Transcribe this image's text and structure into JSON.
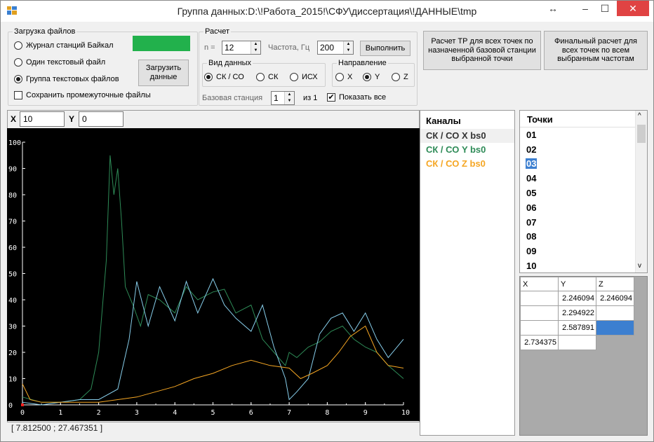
{
  "window": {
    "title": "Группа данных:D:\\!Работа_2015!\\СФУ\\диссертация\\!ДАННЫЕ\\tmp",
    "restore_glyph": "↔",
    "minimize_glyph": "–",
    "maximize_glyph": "☐",
    "close_glyph": "✕"
  },
  "load": {
    "legend": "Загрузка файлов",
    "options": [
      "Журнал станций Байкал",
      "Один текстовый файл",
      "Группа текстовых файлов"
    ],
    "selected": 2,
    "save_intermediate": "Сохранить промежуточные файлы",
    "save_checked": false,
    "load_button": "Загрузить данные",
    "status_color": "#22b14c"
  },
  "calc": {
    "legend": "Расчет",
    "n_label": "n =",
    "n_value": "12",
    "freq_label": "Частота, Гц",
    "freq_value": "200",
    "run_button": "Выполнить",
    "view_legend": "Вид данных",
    "view_options": [
      "СК / СО",
      "СК",
      "ИСХ"
    ],
    "view_selected": 0,
    "dir_legend": "Направление",
    "dir_options": [
      "X",
      "Y",
      "Z"
    ],
    "dir_selected": 1,
    "base_label": "Базовая станция",
    "base_value": "1",
    "base_of": "из 1",
    "show_all": "Показать все",
    "show_all_checked": true
  },
  "actions": {
    "tr_button": "Расчет ТР для всех точек по назначенной базовой станции выбранной точки",
    "final_button": "Финальный расчет для всех точек по всем выбранным частотам"
  },
  "coords": {
    "x_label": "X",
    "x_value": "10",
    "y_label": "Y",
    "y_value": "0"
  },
  "status": {
    "cursor": "[ 7.812500 ; 27.467351 ]"
  },
  "channels": {
    "title": "Каналы",
    "items": [
      {
        "label": "СК / СО X bs0",
        "color": "#333333"
      },
      {
        "label": "СК / СО Y bs0",
        "color": "#2e8b57"
      },
      {
        "label": "СК / СО Z bs0",
        "color": "#f5a623"
      }
    ]
  },
  "points": {
    "title": "Точки",
    "items": [
      "01",
      "02",
      "03",
      "04",
      "05",
      "06",
      "07",
      "08",
      "09",
      "10"
    ],
    "selected": 2
  },
  "grid": {
    "headers": [
      "X",
      "Y",
      "Z"
    ],
    "rows": [
      [
        "",
        "2.246094",
        "2.246094"
      ],
      [
        "",
        "2.294922",
        ""
      ],
      [
        "",
        "2.587891",
        ""
      ],
      [
        "2.734375",
        "",
        ""
      ]
    ]
  },
  "chart_data": {
    "type": "line",
    "xlim": [
      0,
      10
    ],
    "ylim": [
      0,
      100
    ],
    "xticks": [
      0,
      1,
      2,
      3,
      4,
      5,
      6,
      7,
      8,
      9,
      10
    ],
    "yticks": [
      0,
      10,
      20,
      30,
      40,
      50,
      60,
      70,
      80,
      90,
      100
    ],
    "background": "#000000",
    "grid": false,
    "series": [
      {
        "color": "#2e8b57",
        "x": [
          0,
          0.5,
          1,
          1.5,
          1.8,
          2.0,
          2.2,
          2.3,
          2.4,
          2.5,
          2.6,
          2.7,
          2.9,
          3.1,
          3.3,
          3.6,
          4.0,
          4.3,
          4.6,
          5.0,
          5.3,
          5.6,
          6.0,
          6.3,
          6.6,
          6.9,
          7.0,
          7.2,
          7.5,
          7.8,
          8.1,
          8.4,
          8.7,
          9.0,
          9.3,
          9.6,
          10
        ],
        "y": [
          3,
          1,
          1,
          2,
          6,
          20,
          55,
          95,
          80,
          90,
          70,
          45,
          38,
          30,
          42,
          40,
          35,
          45,
          40,
          43,
          44,
          35,
          38,
          25,
          20,
          15,
          20,
          18,
          22,
          24,
          28,
          30,
          25,
          22,
          20,
          15,
          10
        ]
      },
      {
        "color": "#87ceeb",
        "x": [
          0,
          0.5,
          1,
          1.5,
          2.0,
          2.5,
          2.8,
          3.0,
          3.3,
          3.6,
          4.0,
          4.3,
          4.6,
          5.0,
          5.3,
          5.6,
          6.0,
          6.3,
          6.6,
          6.9,
          7.0,
          7.2,
          7.5,
          7.8,
          8.1,
          8.4,
          8.7,
          9.0,
          9.3,
          9.6,
          10
        ],
        "y": [
          1,
          0,
          1,
          2,
          2,
          6,
          25,
          47,
          30,
          45,
          32,
          47,
          35,
          48,
          38,
          33,
          28,
          38,
          22,
          10,
          2,
          5,
          10,
          27,
          33,
          35,
          28,
          35,
          25,
          18,
          25
        ]
      },
      {
        "color": "#f5a623",
        "x": [
          0,
          0.2,
          0.5,
          1,
          1.5,
          2.0,
          2.5,
          3.0,
          3.5,
          4.0,
          4.5,
          5.0,
          5.5,
          6.0,
          6.5,
          7.0,
          7.3,
          7.6,
          8.0,
          8.3,
          8.6,
          9.0,
          9.3,
          9.6,
          10
        ],
        "y": [
          8,
          2,
          1,
          1,
          1,
          1,
          2,
          3,
          5,
          7,
          10,
          12,
          15,
          17,
          15,
          14,
          10,
          12,
          15,
          20,
          26,
          30,
          20,
          15,
          14
        ]
      }
    ]
  }
}
